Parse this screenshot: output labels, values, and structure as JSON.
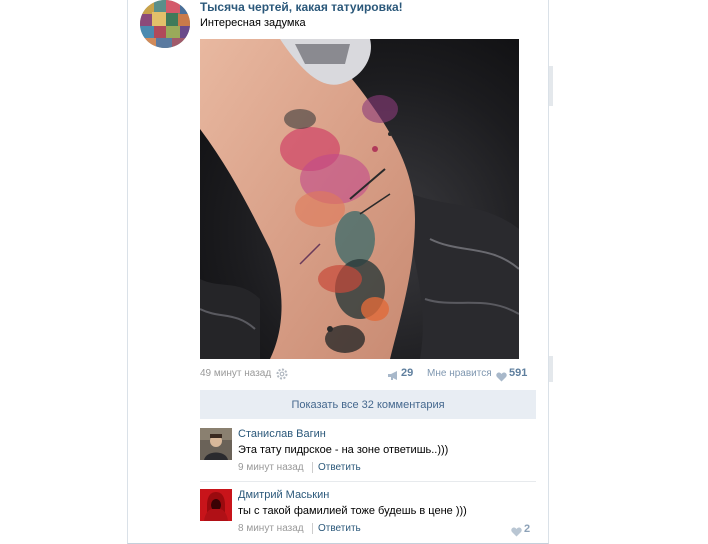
{
  "post": {
    "title": "Тысяча чертей, какая татуировка!",
    "text": "Интересная задумка",
    "time": "49 минут назад",
    "shares": "29",
    "like_label": "Мне нравится",
    "likes": "591",
    "show_all_comments": "Показать все 32 комментария"
  },
  "comments": [
    {
      "author": "Станислав Вагин",
      "text": "Эта тату пидрское - на зоне ответишь..)))",
      "time": "9 минут назад",
      "reply": "Ответить"
    },
    {
      "author": "Дмитрий Маськин",
      "text": "ты с такой фамилией тоже будешь в цене )))",
      "time": "8 минут назад",
      "reply": "Ответить",
      "likes": "2"
    }
  ],
  "icons": {
    "settings": "gear-icon",
    "share": "megaphone-icon",
    "like": "heart-icon"
  },
  "colors": {
    "link": "#2b587a",
    "muted": "#999999",
    "button_bg": "#e8edf3",
    "button_text": "#45688e"
  }
}
